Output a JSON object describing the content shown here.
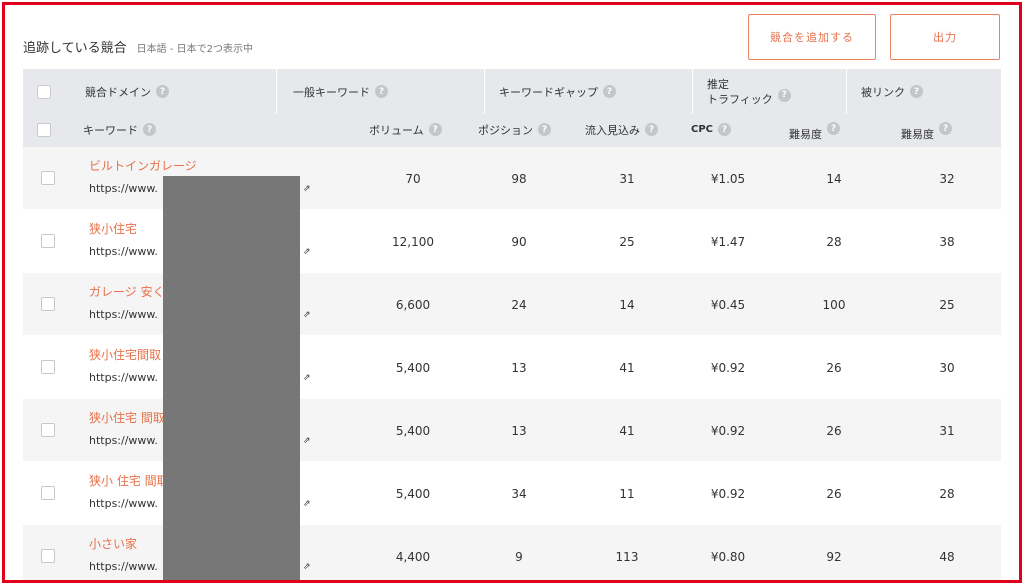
{
  "header": {
    "title": "追跡している競合",
    "subtitle": "日本語 - 日本で2つ表示中"
  },
  "buttons": {
    "add_competitor": "競合を追加する",
    "export": "出力"
  },
  "table": {
    "group_headers": [
      "競合ドメイン",
      "一般キーワード",
      "キーワードギャップ",
      "推定",
      "トラフィック",
      "被リンク"
    ],
    "columns": {
      "keyword": "キーワード",
      "volume": "ボリューム",
      "position": "ポジション",
      "traffic": "流入見込み",
      "cpc": "CPC",
      "paid_difficulty": "難易度",
      "seo_difficulty": "難易度"
    },
    "rows": [
      {
        "keyword": "ビルトインガレージ",
        "url": "https://www.",
        "volume": "70",
        "position": "98",
        "traffic": "31",
        "cpc": "¥1.05",
        "pd": "14",
        "sd": "32"
      },
      {
        "keyword": "狭小住宅",
        "url": "https://www.",
        "volume": "12,100",
        "position": "90",
        "traffic": "25",
        "cpc": "¥1.47",
        "pd": "28",
        "sd": "38"
      },
      {
        "keyword": "ガレージ 安く",
        "url": "https://www.",
        "volume": "6,600",
        "position": "24",
        "traffic": "14",
        "cpc": "¥0.45",
        "pd": "100",
        "sd": "25"
      },
      {
        "keyword": "狭小住宅間取",
        "url": "https://www.",
        "volume": "5,400",
        "position": "13",
        "traffic": "41",
        "cpc": "¥0.92",
        "pd": "26",
        "sd": "30"
      },
      {
        "keyword": "狭小住宅 間取",
        "url": "https://www.",
        "volume": "5,400",
        "position": "13",
        "traffic": "41",
        "cpc": "¥0.92",
        "pd": "26",
        "sd": "31"
      },
      {
        "keyword": "狭小 住宅 間取",
        "url": "https://www.",
        "volume": "5,400",
        "position": "34",
        "traffic": "11",
        "cpc": "¥0.92",
        "pd": "26",
        "sd": "28"
      },
      {
        "keyword": "小さい家",
        "url": "https://www.",
        "volume": "4,400",
        "position": "9",
        "traffic": "113",
        "cpc": "¥0.80",
        "pd": "92",
        "sd": "48"
      }
    ]
  },
  "icons": {
    "help": "?",
    "external_link": "⇗"
  },
  "colors": {
    "accent": "#e8704a",
    "frame": "#e0001b",
    "header_bg": "#e6e8eb"
  }
}
